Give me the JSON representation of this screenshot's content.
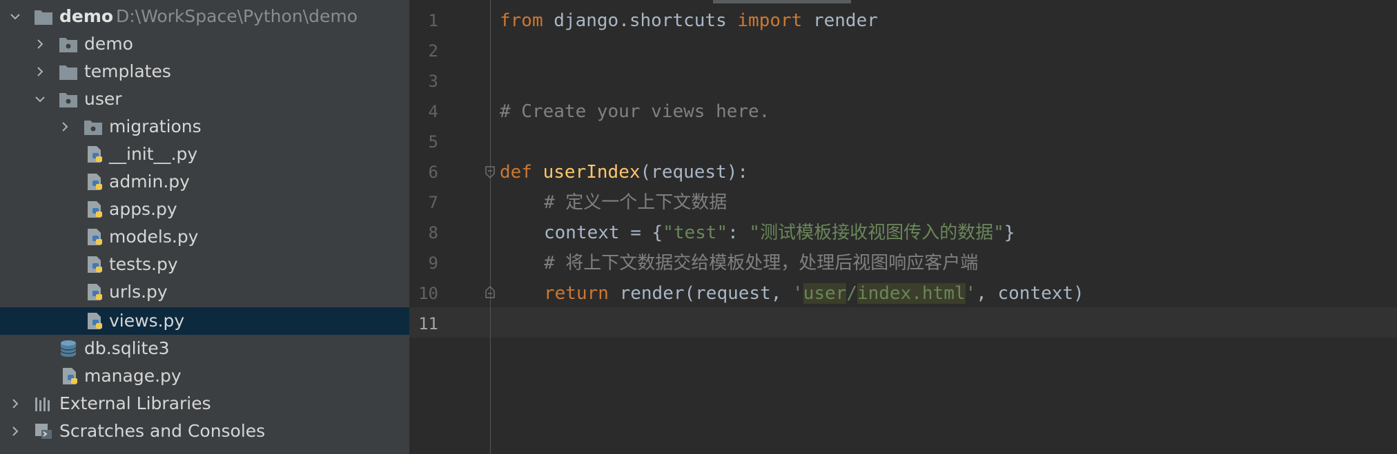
{
  "colors": {
    "tree_bg": "#3c3f41",
    "editor_bg": "#2b2b2b",
    "selection": "#0d293e",
    "keyword": "#cc7832",
    "function": "#ffc66d",
    "comment": "#808080",
    "string": "#6a8759"
  },
  "tree": {
    "root": {
      "name": "demo",
      "path": "D:\\WorkSpace\\Python\\demo",
      "icon": "folder-icon"
    },
    "items": [
      {
        "label": "demo",
        "icon": "package-folder-icon"
      },
      {
        "label": "templates",
        "icon": "folder-icon"
      },
      {
        "label": "user",
        "icon": "package-folder-icon"
      },
      {
        "label": "migrations",
        "icon": "package-folder-icon"
      },
      {
        "label": "__init__.py",
        "icon": "python-file-icon"
      },
      {
        "label": "admin.py",
        "icon": "python-file-icon"
      },
      {
        "label": "apps.py",
        "icon": "python-file-icon"
      },
      {
        "label": "models.py",
        "icon": "python-file-icon"
      },
      {
        "label": "tests.py",
        "icon": "python-file-icon"
      },
      {
        "label": "urls.py",
        "icon": "python-file-icon"
      },
      {
        "label": "views.py",
        "icon": "python-file-icon"
      },
      {
        "label": "db.sqlite3",
        "icon": "database-icon"
      },
      {
        "label": "manage.py",
        "icon": "python-file-icon"
      },
      {
        "label": "External Libraries",
        "icon": "libraries-icon"
      },
      {
        "label": "Scratches and Consoles",
        "icon": "scratches-icon"
      }
    ]
  },
  "editor": {
    "line_numbers": [
      "1",
      "2",
      "3",
      "4",
      "5",
      "6",
      "7",
      "8",
      "9",
      "10",
      "11"
    ],
    "code": {
      "l1": {
        "kw1": "from",
        "mod": " django.shortcuts ",
        "kw2": "import",
        "name": " render"
      },
      "l4": {
        "comment": "# Create your views here."
      },
      "l6": {
        "kw": "def",
        "sp": " ",
        "fn": "userIndex",
        "rest": "(request):"
      },
      "l7": {
        "comment": "# 定义一个上下文数据"
      },
      "l8": {
        "a": "context = {",
        "key": "\"test\"",
        "colon": ": ",
        "val": "\"测试模板接收视图传入的数据\"",
        "end": "}"
      },
      "l9": {
        "comment": "# 将上下文数据交给模板处理，处理后视图响应客户端"
      },
      "l10": {
        "kw": "return",
        "a": " render(request, ",
        "q1": "'",
        "s1": "user",
        "slash": "/",
        "s2": "index.html",
        "q2": "'",
        "b": ", context)"
      }
    }
  }
}
